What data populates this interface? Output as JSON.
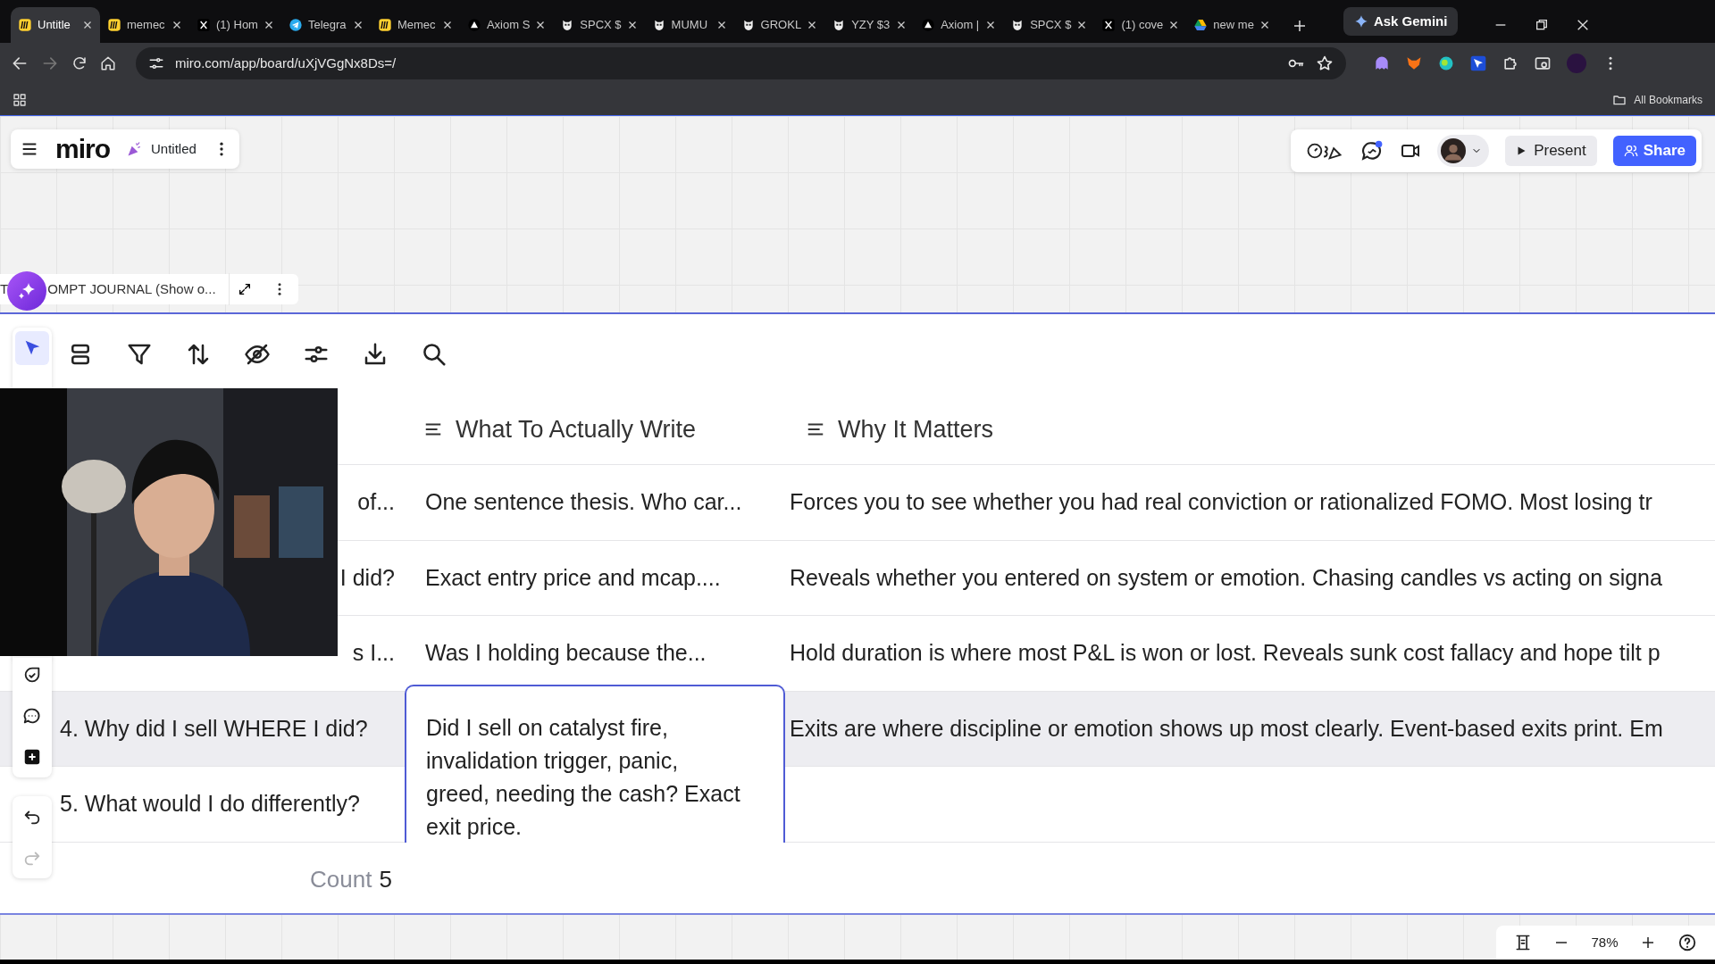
{
  "browser": {
    "tabs": [
      {
        "title": "Untitle",
        "kind": "miro",
        "selected": true
      },
      {
        "title": "memec",
        "kind": "miro",
        "selected": false
      },
      {
        "title": "(1) Hom",
        "kind": "x",
        "selected": false
      },
      {
        "title": "Telegra",
        "kind": "telegram",
        "selected": false
      },
      {
        "title": "Memec",
        "kind": "miro",
        "selected": false
      },
      {
        "title": "Axiom S",
        "kind": "axiom",
        "selected": false
      },
      {
        "title": "SPCX $",
        "kind": "mask",
        "selected": false
      },
      {
        "title": "MUMU",
        "kind": "mask",
        "selected": false
      },
      {
        "title": "GROKL",
        "kind": "mask",
        "selected": false
      },
      {
        "title": "YZY $3",
        "kind": "mask",
        "selected": false
      },
      {
        "title": "Axiom |",
        "kind": "axiom",
        "selected": false
      },
      {
        "title": "SPCX $",
        "kind": "mask",
        "selected": false
      },
      {
        "title": "(1) cove",
        "kind": "x",
        "selected": false
      },
      {
        "title": "new me",
        "kind": "drive",
        "selected": false
      }
    ],
    "ask_gemini": "Ask Gemini",
    "url": "miro.com/app/board/uXjVGgNx8Ds=/",
    "forward_disabled": true,
    "all_bookmarks": "All Bookmarks"
  },
  "board": {
    "logo": "miro",
    "title": "Untitled",
    "comments_unread": true,
    "present": "Present",
    "share": "Share",
    "table": {
      "title_prefix": "T",
      "title": "OMPT JOURNAL (Show o...",
      "tools_top": [
        {
          "kind": "select",
          "selected": true
        }
      ],
      "tools_bottom": [
        {
          "kind": "sticker",
          "selected": false
        },
        {
          "kind": "comment",
          "selected": false
        },
        {
          "kind": "plus",
          "selected": false
        }
      ],
      "history": [
        {
          "kind": "undo",
          "disabled": false
        },
        {
          "kind": "redo",
          "disabled": true
        }
      ],
      "columns": [
        {
          "label": "What To Actually Write"
        },
        {
          "label": "Why It Matters"
        }
      ],
      "rows": [
        {
          "kind": "partial",
          "question": "of...",
          "answer": "One sentence thesis. Who car...",
          "why": "Forces you to see whether you had real conviction or rationalized FOMO. Most losing tr",
          "highlighted": false,
          "editing": false
        },
        {
          "kind": "partial",
          "question": "I did?",
          "answer": "Exact entry price and mcap....",
          "why": "Reveals whether you entered on system or emotion. Chasing candles vs acting on signa",
          "highlighted": false,
          "editing": false
        },
        {
          "kind": "partial",
          "question": "s I...",
          "answer": "Was I holding because the...",
          "why": "Hold duration is where most P&L is won or lost. Reveals sunk cost fallacy and hope tilt p",
          "highlighted": false,
          "editing": false
        },
        {
          "kind": "full",
          "question": "4. Why did I sell WHERE I did?",
          "answer": "Did I sell on catalyst fire, invalidation trigger, panic, greed, needing the cash? Exact exit price.",
          "why": "Exits are where discipline or emotion shows up most clearly. Event-based exits print. Em",
          "highlighted": true,
          "editing": true
        },
        {
          "kind": "full",
          "question": "5. What would I do differently?",
          "highlighted": false,
          "editing": false
        }
      ],
      "count_label": "Count",
      "count": "5"
    },
    "zoom": "78%"
  }
}
